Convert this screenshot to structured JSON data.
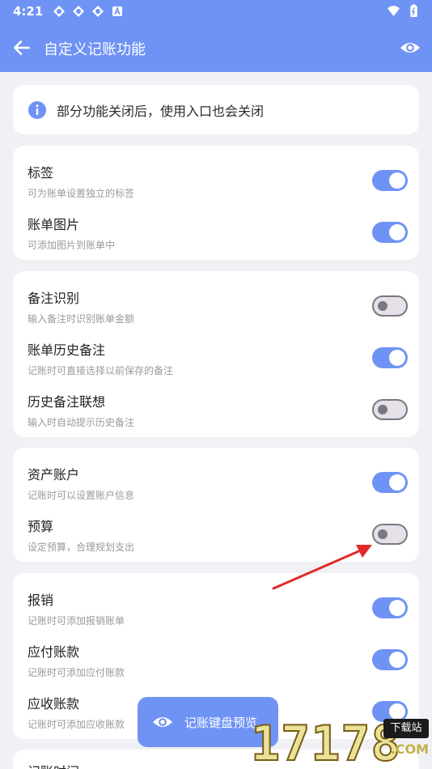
{
  "status_bar": {
    "time": "4:21"
  },
  "header": {
    "title": "自定义记账功能"
  },
  "info": {
    "text": "部分功能关闭后，使用入口也会关闭"
  },
  "groups": [
    {
      "items": [
        {
          "title": "标签",
          "subtitle": "可为账单设置独立的标签",
          "enabled": true
        },
        {
          "title": "账单图片",
          "subtitle": "可添加图片到账单中",
          "enabled": true
        }
      ]
    },
    {
      "items": [
        {
          "title": "备注识别",
          "subtitle": "输入备注时识别账单金额",
          "enabled": false
        },
        {
          "title": "账单历史备注",
          "subtitle": "记账时可直接选择以前保存的备注",
          "enabled": true
        },
        {
          "title": "历史备注联想",
          "subtitle": "输入时自动提示历史备注",
          "enabled": false
        }
      ]
    },
    {
      "items": [
        {
          "title": "资产账户",
          "subtitle": "记账时可以设置账户信息",
          "enabled": true
        },
        {
          "title": "预算",
          "subtitle": "设定预算，合理规划支出",
          "enabled": false
        }
      ]
    },
    {
      "items": [
        {
          "title": "报销",
          "subtitle": "记账时可添加报销账单",
          "enabled": true
        },
        {
          "title": "应付账款",
          "subtitle": "记账时可添加应付账款",
          "enabled": true
        },
        {
          "title": "应收账款",
          "subtitle": "记账时可添加应收账款",
          "enabled": true
        }
      ]
    }
  ],
  "partial_next_item": "记账时间",
  "floating_button": {
    "label": "记账键盘预览"
  },
  "watermark": {
    "number": "17178",
    "badge": "下载站",
    "suffix": ".COM"
  },
  "colors": {
    "accent": "#6f93f5",
    "background": "#f1f1f5",
    "annotation_arrow": "#e02a2a"
  }
}
